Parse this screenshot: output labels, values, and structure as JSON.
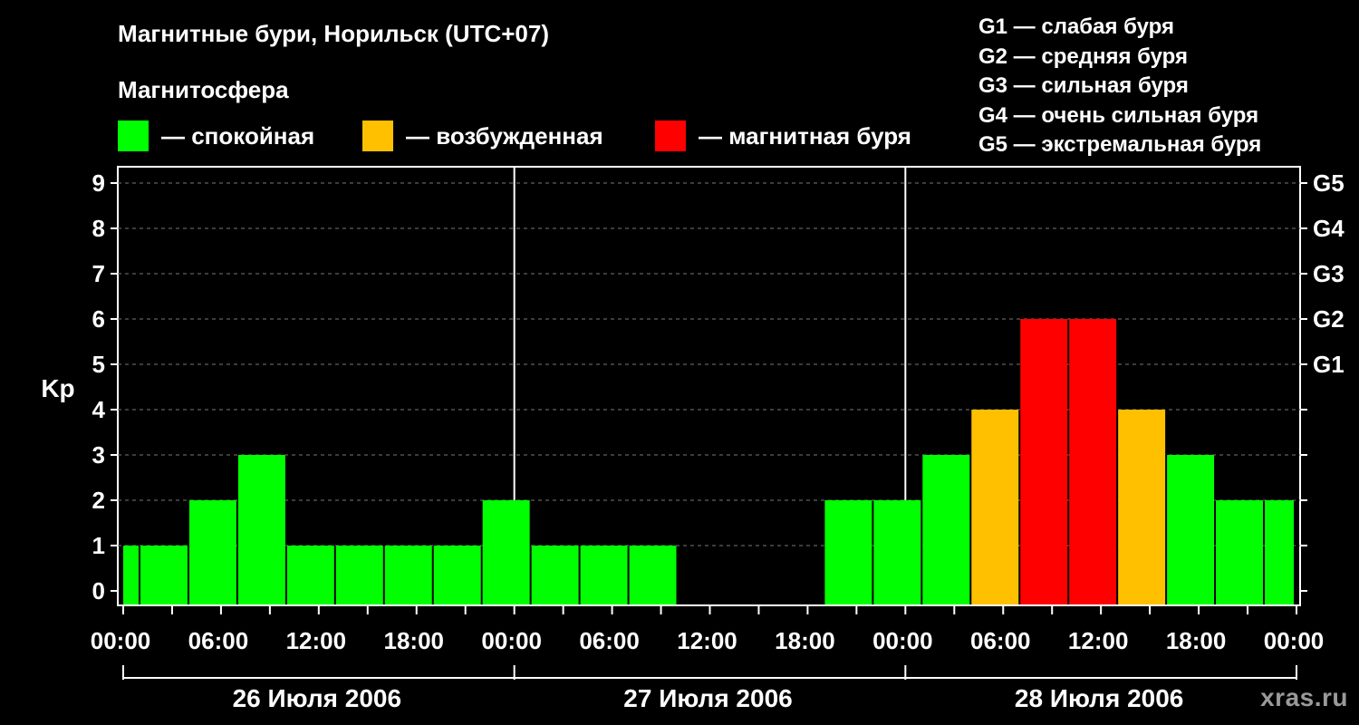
{
  "header": {
    "title": "Магнитные бури, Норильск (UTC+07)",
    "subtitle": "Магнитосфера"
  },
  "legend": [
    {
      "label": "— спокойная",
      "color": "#00ff00"
    },
    {
      "label": "— возбужденная",
      "color": "#ffc000"
    },
    {
      "label": "— магнитная буря",
      "color": "#ff0000"
    }
  ],
  "gscale": [
    "G1 — слабая буря",
    "G2 — средняя буря",
    "G3 — сильная буря",
    "G4 — очень сильная буря",
    "G5 — экстремальная буря"
  ],
  "watermark": "xras.ru",
  "chart_data": {
    "type": "bar",
    "ylabel": "Kp",
    "ylim": [
      0,
      9
    ],
    "yticks": [
      "0",
      "1",
      "2",
      "3",
      "4",
      "5",
      "6",
      "7",
      "8",
      "9"
    ],
    "right_ticks": [
      {
        "value": 5,
        "label": "G1"
      },
      {
        "value": 6,
        "label": "G2"
      },
      {
        "value": 7,
        "label": "G3"
      },
      {
        "value": 8,
        "label": "G4"
      },
      {
        "value": 9,
        "label": "G5"
      }
    ],
    "xticks": [
      "00:00",
      "06:00",
      "12:00",
      "18:00",
      "00:00",
      "06:00",
      "12:00",
      "18:00",
      "00:00",
      "06:00",
      "12:00",
      "18:00",
      "00:00"
    ],
    "days": [
      "26 Июля 2006",
      "27 Июля 2006",
      "28 Июля 2006"
    ],
    "grid": true,
    "values": [
      1,
      1,
      2,
      3,
      1,
      1,
      1,
      1,
      2,
      1,
      1,
      1,
      0,
      0,
      0,
      2,
      2,
      3,
      4,
      6,
      6,
      4,
      3,
      2,
      2
    ],
    "colors": {
      "quiet": "#00ff00",
      "active": "#ffc000",
      "storm": "#ff0000"
    }
  }
}
